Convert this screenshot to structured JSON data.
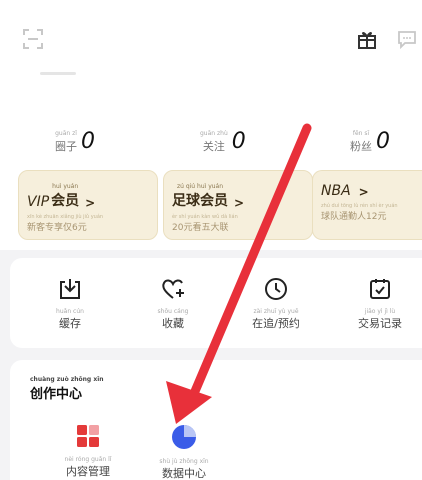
{
  "stats": [
    {
      "pinyin": "guān zǐ",
      "label": "圈子",
      "value": "0"
    },
    {
      "pinyin": "guān zhù",
      "label": "关注",
      "value": "0"
    },
    {
      "pinyin": "fěn sī",
      "label": "粉丝",
      "value": "0"
    }
  ],
  "member_cards": [
    {
      "prefix": "VIP",
      "pinyin": "huì yuán",
      "title": "会员",
      "arrow": ">",
      "sub_pinyin": "xīn kè zhuān xiǎng jiù jiǔ yuán",
      "sub": "新客专享仅6元"
    },
    {
      "prefix": "",
      "pinyin": "zú qiú huì yuán",
      "title": "足球会员",
      "arrow": ">",
      "sub_pinyin": "èr shí yuán kàn wǔ dà lián",
      "sub": "20元看五大联"
    },
    {
      "prefix": "NBA",
      "pinyin": "",
      "title": "",
      "arrow": ">",
      "sub_pinyin": "zhú duì tōng lù rén shí èr yuán",
      "sub": "球队通勤人12元"
    }
  ],
  "tools": [
    {
      "icon": "download-box-icon",
      "pinyin": "huǎn cún",
      "label": "缓存"
    },
    {
      "icon": "heart-plus-icon",
      "pinyin": "shōu cáng",
      "label": "收藏"
    },
    {
      "icon": "clock-icon",
      "pinyin": "zài zhuī yù yuē",
      "label": "在追/预约"
    },
    {
      "icon": "calendar-check-icon",
      "pinyin": "jiāo yì jì lù",
      "label": "交易记录"
    }
  ],
  "creator": {
    "title_pinyin": "chuàng zuò zhōng xīn",
    "title": "创作中心",
    "items": [
      {
        "icon": "content-grid-icon",
        "pinyin": "nèi róng guǎn lǐ",
        "label": "内容管理"
      },
      {
        "icon": "pie-chart-icon",
        "pinyin": "shù jù zhōng xīn",
        "label": "数据中心"
      }
    ]
  },
  "colors": {
    "accent_red": "#e8303a",
    "card_gold_bg": "#f6efdc",
    "data_blue": "#3a5ce8",
    "content_red": "#e43a3a"
  }
}
